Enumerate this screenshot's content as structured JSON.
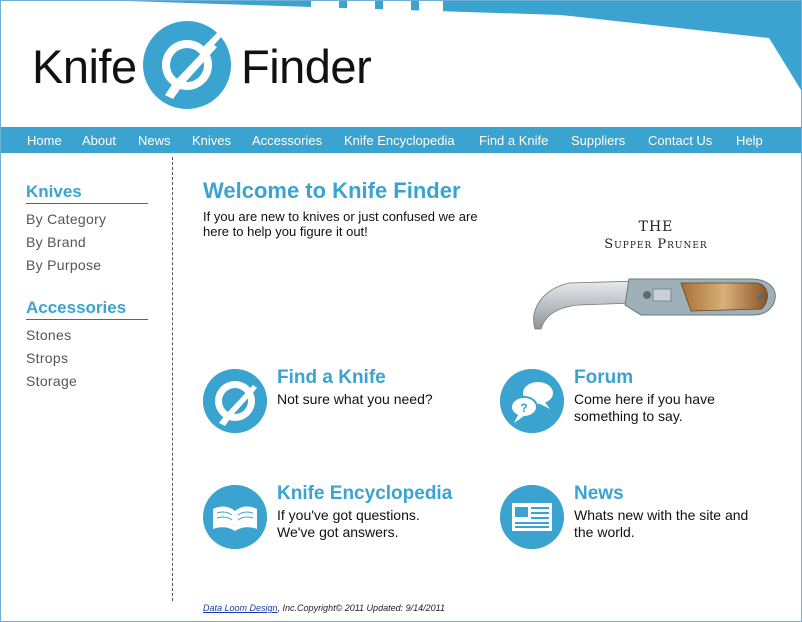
{
  "header": {
    "brand_left": "Knife",
    "brand_right": "Finder"
  },
  "nav": {
    "items": [
      "Home",
      "About",
      "News",
      "Knives",
      "Accessories",
      "Knife Encyclopedia",
      "Find a Knife",
      "Suppliers",
      "Contact Us",
      "Help"
    ]
  },
  "sidebar": {
    "knives_heading": "Knives",
    "knives_links": [
      "By Category",
      "By Brand",
      "By Purpose"
    ],
    "accessories_heading": "Accessories",
    "accessories_links": [
      "Stones",
      "Strops",
      "Storage"
    ]
  },
  "main": {
    "title": "Welcome to Knife Finder",
    "intro": "If you are new to knives or just confused we are here to help you figure it out!",
    "product_title_line1": "THE",
    "product_title_line2": "Supper Pruner",
    "features": [
      {
        "title": "Find a Knife",
        "line1": "Not sure what you need?",
        "line2": ""
      },
      {
        "title": "Forum",
        "line1": "Come here if you have",
        "line2": "something to say."
      },
      {
        "title": "Knife Encyclopedia",
        "line1": "If you've got questions.",
        "line2": "We've got answers."
      },
      {
        "title": "News",
        "line1": "Whats new with the site and",
        "line2": "the world."
      }
    ]
  },
  "footer": {
    "link": "Data Loom Design",
    "text": ", Inc.Copyright© 2011 Updated: 9/14/2011"
  },
  "colors": {
    "accent": "#3ba3d0",
    "text": "#111111",
    "sidebar_link": "#555555"
  }
}
